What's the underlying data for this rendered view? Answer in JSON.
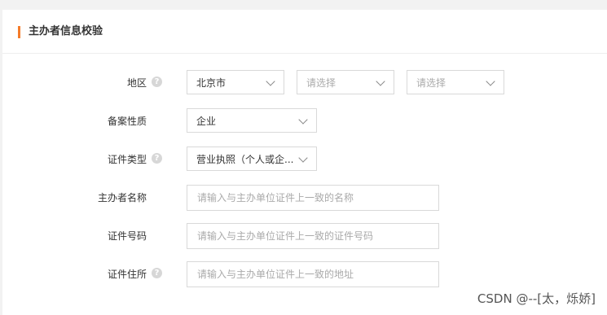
{
  "section": {
    "title": "主办者信息校验"
  },
  "fields": {
    "region": {
      "label": "地区",
      "province": "北京市",
      "city_placeholder": "请选择",
      "district_placeholder": "请选择"
    },
    "filing_nature": {
      "label": "备案性质",
      "value": "企业"
    },
    "certificate_type": {
      "label": "证件类型",
      "value": "营业执照（个人或企..."
    },
    "sponsor_name": {
      "label": "主办者名称",
      "placeholder": "请输入与主办单位证件上一致的名称"
    },
    "certificate_number": {
      "label": "证件号码",
      "placeholder": "请输入与主办单位证件上一致的证件号码"
    },
    "certificate_address": {
      "label": "证件住所",
      "placeholder": "请输入与主办单位证件上一致的地址"
    }
  },
  "icons": {
    "help": "?"
  },
  "colors": {
    "accent": "#f57c2a",
    "border": "#d9d9d9",
    "placeholder": "#aaaaaa"
  },
  "watermark": "CSDN @--[太，烁娇]"
}
